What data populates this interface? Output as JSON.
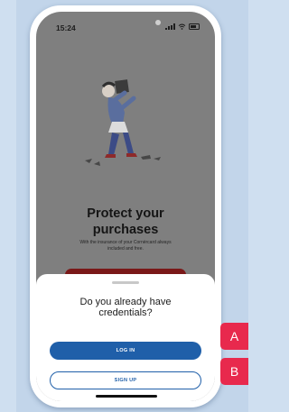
{
  "status_bar": {
    "time": "15:24"
  },
  "onboarding": {
    "title_line1": "Protect your",
    "title_line2": "purchases",
    "subtitle_line1": "With the insurance of your Cornèrcard always",
    "subtitle_line2": "included and free."
  },
  "sheet": {
    "title_line1": "Do you already have",
    "title_line2": "credentials?",
    "login_label": "LOG IN",
    "signup_label": "SIGN UP"
  },
  "annotations": {
    "tag_a": "A",
    "tag_b": "B"
  },
  "colors": {
    "primary_button": "#1f5fa9",
    "annotation_tag": "#e8294d",
    "background": "#cfdff0",
    "overlay": "#7f7f7f"
  },
  "icons": [
    "signal-icon",
    "wifi-icon",
    "battery-icon"
  ]
}
